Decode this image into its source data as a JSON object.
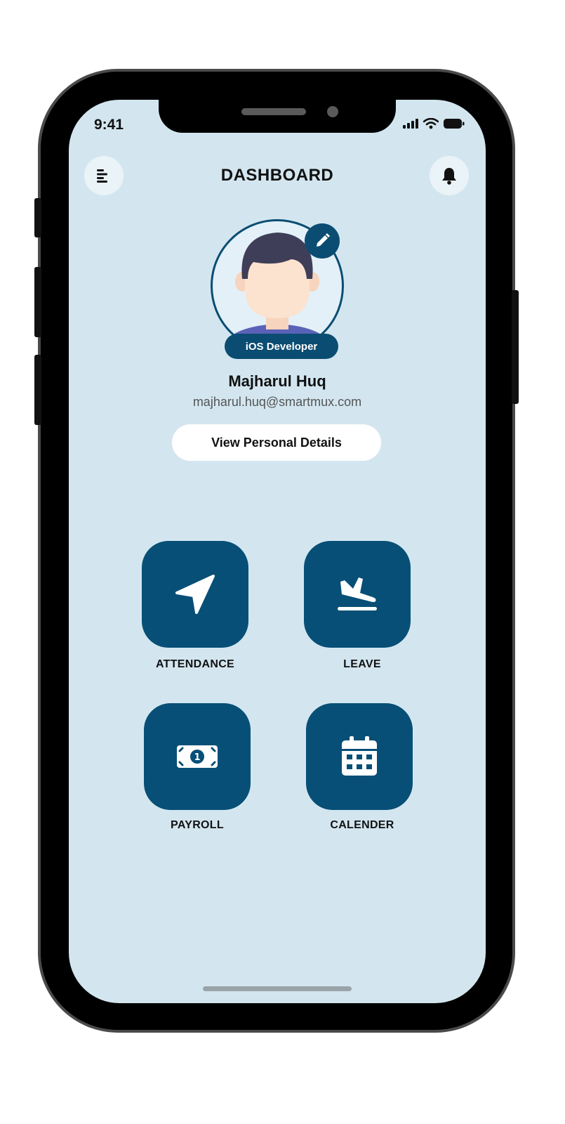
{
  "status_bar": {
    "time": "9:41"
  },
  "header": {
    "title": "DASHBOARD",
    "menu_icon": "menu-icon",
    "notification_icon": "bell-icon"
  },
  "profile": {
    "role": "iOS Developer",
    "name": "Majharul Huq",
    "email": "majharul.huq@smartmux.com",
    "details_button": "View Personal Details",
    "edit_icon": "pencil-icon"
  },
  "tiles": [
    {
      "label": "ATTENDANCE",
      "icon": "navigation-arrow-icon"
    },
    {
      "label": "LEAVE",
      "icon": "plane-landing-icon"
    },
    {
      "label": "PAYROLL",
      "icon": "money-bill-icon"
    },
    {
      "label": "CALENDER",
      "icon": "calendar-icon"
    }
  ],
  "colors": {
    "screen_background": "#d3e6f0",
    "primary": "#074f76"
  }
}
